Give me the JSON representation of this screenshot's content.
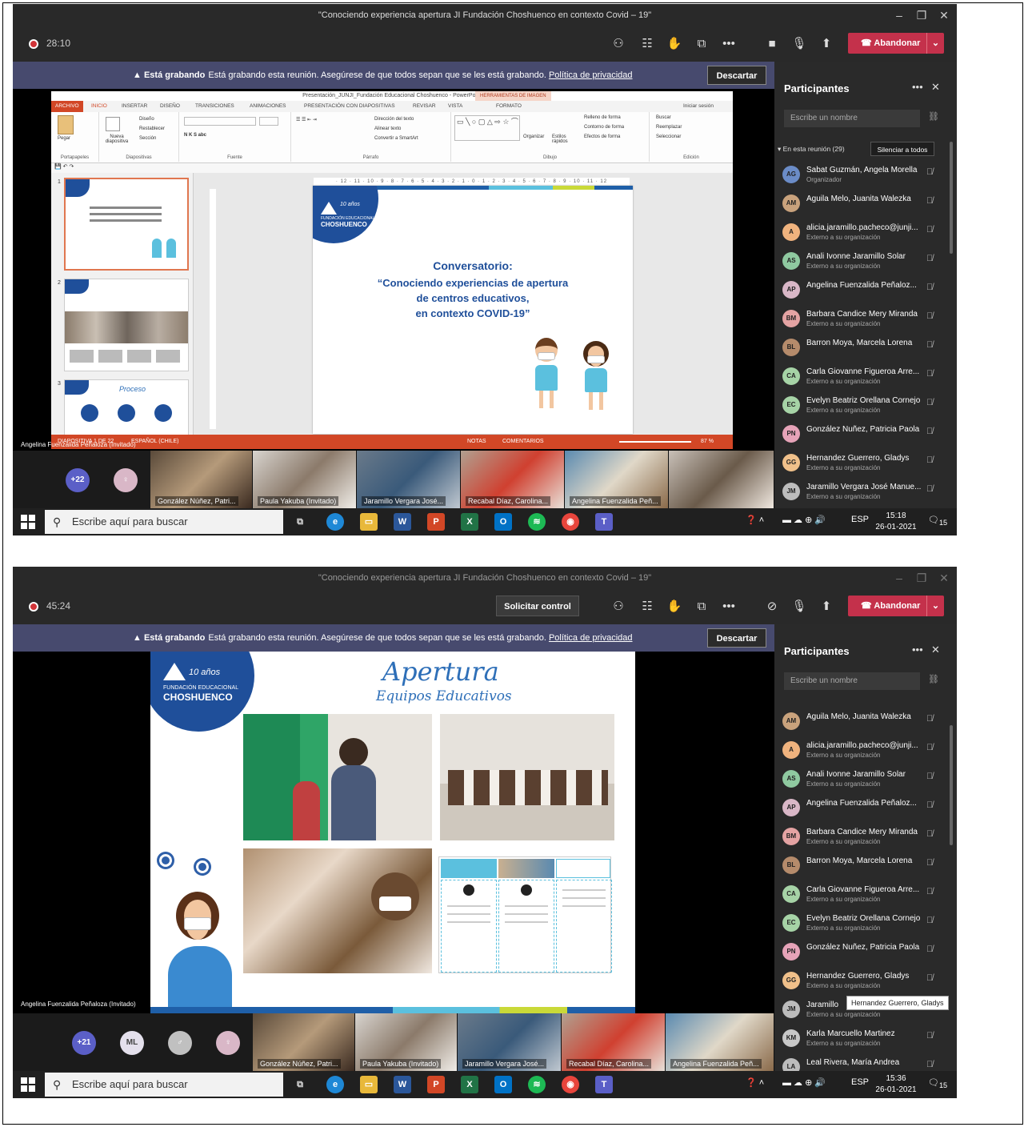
{
  "colors": {
    "teams_bg": "#292929",
    "leave_red": "#c4314b",
    "banner": "#474a6e",
    "ppt_orange": "#d24726",
    "brand_blue": "#1f4f9a"
  },
  "icons": [
    "close-icon",
    "minimize-icon",
    "maximize-icon",
    "record-icon",
    "people-icon",
    "chat-icon",
    "raise-hand-icon",
    "rooms-icon",
    "more-icon",
    "camera-icon",
    "mic-icon",
    "share-icon",
    "phone-icon",
    "chevron-down-icon",
    "search-icon",
    "link-icon",
    "windows-start-icon",
    "task-view-icon",
    "edge-icon",
    "explorer-icon",
    "word-icon",
    "powerpoint-icon",
    "excel-icon",
    "outlook-icon",
    "spotify-icon",
    "chrome-icon",
    "teams-icon",
    "help-icon",
    "wifi-icon",
    "volume-icon",
    "notification-icon"
  ],
  "meeting_title": "\"Conociendo experiencia apertura JI Fundación Choshuenco en contexto Covid – 19\"",
  "leave_label": "Abandonar",
  "recording": {
    "bold": "Está grabando",
    "text": "Está grabando esta reunión. Asegúrese de que todos sepan que se les está grabando.",
    "link": "Política de privacidad",
    "dismiss": "Descartar"
  },
  "panel": {
    "title": "Participantes",
    "search_placeholder": "Escribe un nombre",
    "group": "En esta reunión (29)",
    "mute_all": "Silenciar a todos"
  },
  "external": "Externo a su organización",
  "taskbar": {
    "search": "Escribe aquí para buscar",
    "lang": "ESP",
    "date": "26-01-2021",
    "notif": "15"
  },
  "presenter_label": "Angelina Fuenzalida Peñaloza (Invitado)",
  "shot1": {
    "timer": "28:10",
    "time": "15:18",
    "ppt": {
      "window_title": "Presentación_JUNJI_Fundación Educacional Choshuenco - PowerPoint",
      "tools_tab": "HERRAMIENTAS DE IMAGEN",
      "tabs": [
        "ARCHIVO",
        "INICIO",
        "INSERTAR",
        "DISEÑO",
        "TRANSICIONES",
        "ANIMACIONES",
        "PRESENTACIÓN CON DIAPOSITIVAS",
        "REVISAR",
        "VISTA",
        "FORMATO"
      ],
      "signin": "Iniciar sesión",
      "groups": [
        "Portapapeles",
        "Diapositivas",
        "Fuente",
        "Párrafo",
        "Dibujo",
        "Edición"
      ],
      "clipboard": {
        "paste": "Pegar"
      },
      "slides": {
        "new": "Nueva diapositiva",
        "layout": "Diseño",
        "reset": "Restablecer",
        "section": "Sección"
      },
      "paragraph": {
        "dir": "Dirección del texto",
        "align": "Alinear texto",
        "smartart": "Convertir a SmartArt"
      },
      "drawing": {
        "arrange": "Organizar",
        "styles": "Estilos rápidos",
        "fill": "Relleno de forma",
        "outline": "Contorno de forma",
        "effects": "Efectos de forma"
      },
      "editing": {
        "find": "Buscar",
        "replace": "Reemplazar",
        "select": "Seleccionar"
      },
      "thumb_nums": [
        "1",
        "2",
        "3"
      ],
      "thumb3_title": "Proceso",
      "status": {
        "slide": "DIAPOSITIVA 1 DE 22",
        "lang": "ESPAÑOL (CHILE)",
        "notes": "NOTAS",
        "comments": "COMENTARIOS",
        "zoom": "87 %"
      },
      "ruler": "· 12 · 11 · 10 · 9 · 8 · 7 · 6 · 5 · 4 · 3 · 2 · 1 · 0 · 1 · 2 · 3 · 4 · 5 · 6 · 7 · 8 · 9 · 10 · 11 · 12"
    },
    "slide": {
      "logo_years": "10 años",
      "logo_org": "FUNDACIÓN EDUCACIONAL",
      "logo_name": "CHOSHUENCO",
      "title": "Conversatorio:",
      "line1": "“Conociendo experiencias de apertura",
      "line2": "de centros educativos,",
      "line3": "en contexto COVID-19”"
    },
    "strip": {
      "more": "+22",
      "tiles": [
        "González Núñez, Patri...",
        "Paula Yakuba (Invitado)",
        "Jaramillo Vergara José...",
        "Recabal Díaz, Carolina...",
        "Angelina Fuenzalida Peñ..."
      ]
    },
    "participants": [
      {
        "initials": "AG",
        "name": "Sabat Guzmán, Angela Morella",
        "sub": "Organizador",
        "bg": "#6b8cc7"
      },
      {
        "initials": "AM",
        "name": "Aguila Melo, Juanita Walezka",
        "sub": "",
        "bg": "#c9a27c"
      },
      {
        "initials": "A",
        "name": "alicia.jaramillo.pacheco@junji...",
        "sub": "Externo a su organización",
        "bg": "#f0b37e"
      },
      {
        "initials": "AS",
        "name": "Anali Ivonne Jaramillo Solar",
        "sub": "Externo a su organización",
        "bg": "#8fc9a0"
      },
      {
        "initials": "AP",
        "name": "Angelina Fuenzalida Peñaloz...",
        "sub": "",
        "bg": "#d9b7c7"
      },
      {
        "initials": "BM",
        "name": "Barbara Candice Mery Miranda",
        "sub": "Externo a su organización",
        "bg": "#e4a3a3"
      },
      {
        "initials": "BL",
        "name": "Barron Moya, Marcela Lorena",
        "sub": "",
        "bg": "#b58b6b"
      },
      {
        "initials": "CA",
        "name": "Carla Giovanne Figueroa Arre...",
        "sub": "Externo a su organización",
        "bg": "#a6d3a6"
      },
      {
        "initials": "EC",
        "name": "Evelyn Beatriz Orellana Cornejo",
        "sub": "Externo a su organización",
        "bg": "#a6d3a6"
      },
      {
        "initials": "PN",
        "name": "González Nuñez, Patricia Paola",
        "sub": "",
        "bg": "#e6a3b8"
      },
      {
        "initials": "GG",
        "name": "Hernandez Guerrero, Gladys",
        "sub": "Externo a su organización",
        "bg": "#f0c08a"
      },
      {
        "initials": "JM",
        "name": "Jaramillo Vergara José Manue...",
        "sub": "Externo a su organización",
        "bg": "#bcbcbc"
      }
    ]
  },
  "shot2": {
    "timer": "45:24",
    "time": "15:36",
    "request_control": "Solicitar control",
    "slide": {
      "title": "Apertura",
      "subtitle": "Equipos Educativos",
      "logo_years": "10 años",
      "logo_org": "FUNDACIÓN EDUCACIONAL",
      "logo_name": "CHOSHUENCO"
    },
    "strip": {
      "more": "+21",
      "ml": "ML",
      "tiles": [
        "González Núñez, Patri...",
        "Paula Yakuba (Invitado)",
        "Jaramillo Vergara José...",
        "Recabal Díaz, Carolina...",
        "Angelina Fuenzalida Peñ..."
      ]
    },
    "tooltip": "Hernandez Guerrero, Gladys",
    "participants": [
      {
        "initials": "AM",
        "name": "Aguila Melo, Juanita Walezka",
        "sub": "",
        "bg": "#c9a27c"
      },
      {
        "initials": "A",
        "name": "alicia.jaramillo.pacheco@junji...",
        "sub": "Externo a su organización",
        "bg": "#f0b37e"
      },
      {
        "initials": "AS",
        "name": "Anali Ivonne Jaramillo Solar",
        "sub": "Externo a su organización",
        "bg": "#8fc9a0"
      },
      {
        "initials": "AP",
        "name": "Angelina Fuenzalida Peñaloz...",
        "sub": "",
        "bg": "#d9b7c7"
      },
      {
        "initials": "BM",
        "name": "Barbara Candice Mery Miranda",
        "sub": "Externo a su organización",
        "bg": "#e4a3a3"
      },
      {
        "initials": "BL",
        "name": "Barron Moya, Marcela Lorena",
        "sub": "",
        "bg": "#b58b6b"
      },
      {
        "initials": "CA",
        "name": "Carla Giovanne Figueroa Arre...",
        "sub": "Externo a su organización",
        "bg": "#a6d3a6"
      },
      {
        "initials": "EC",
        "name": "Evelyn Beatriz Orellana Cornejo",
        "sub": "Externo a su organización",
        "bg": "#a6d3a6"
      },
      {
        "initials": "PN",
        "name": "González Nuñez, Patricia Paola",
        "sub": "",
        "bg": "#e6a3b8"
      },
      {
        "initials": "GG",
        "name": "Hernandez Guerrero, Gladys",
        "sub": "Externo a su organización",
        "bg": "#f0c08a"
      },
      {
        "initials": "JM",
        "name": "Jaramillo",
        "sub": "Externo a su organización",
        "bg": "#bcbcbc"
      },
      {
        "initials": "KM",
        "name": "Karla Marcuello Martinez",
        "sub": "Externo a su organización",
        "bg": "#c7c7c7"
      },
      {
        "initials": "LA",
        "name": "Leal Rivera, María Andrea",
        "sub": "",
        "bg": "#bcbcbc"
      }
    ]
  }
}
